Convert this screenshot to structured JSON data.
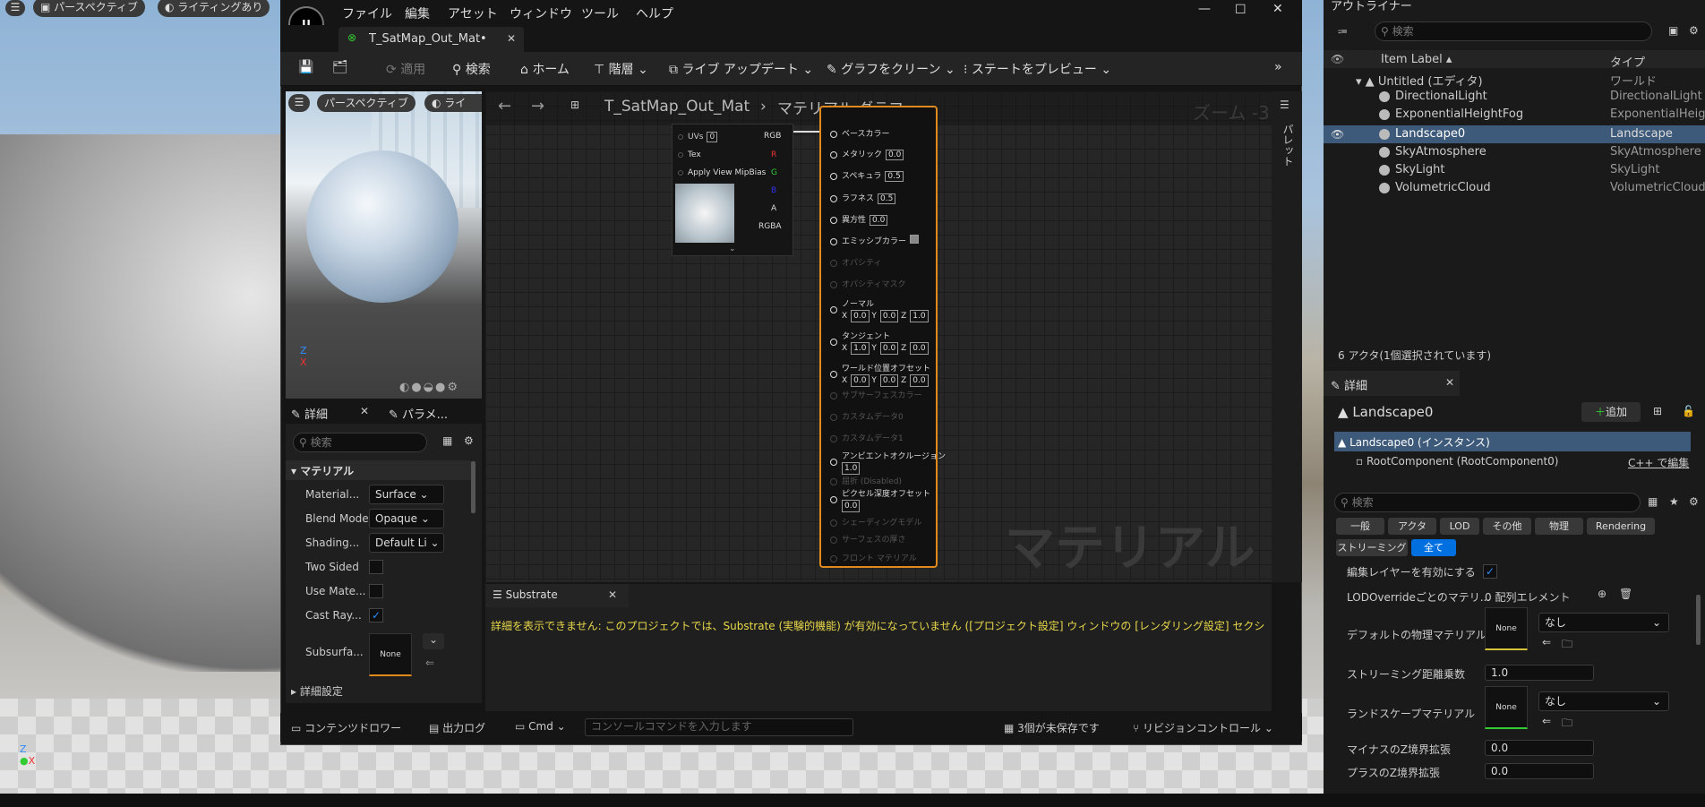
{
  "viewport": {
    "perspective": "パースペクティブ",
    "lighting": "ライティングあり"
  },
  "menu": {
    "file": "ファイル",
    "edit": "編集",
    "asset": "アセット",
    "window": "ウィンドウ",
    "tools": "ツール",
    "help": "ヘルプ"
  },
  "tab": {
    "title": "T_SatMap_Out_Mat•"
  },
  "toolbar": {
    "apply": "適用",
    "search": "検索",
    "home": "ホーム",
    "hierarchy": "階層",
    "live_update": "ライブ アップデート",
    "clean_graph": "グラフをクリーン",
    "preview_state": "ステートをプレビュー"
  },
  "preview": {
    "perspective": "パースペクティブ",
    "lighting": "ライテ"
  },
  "graph": {
    "breadcrumb_asset": "T_SatMap_Out_Mat",
    "breadcrumb_graph": "マテリアル グラフ",
    "zoom": "ズーム -3",
    "watermark": "マテリアル",
    "palette": "パレット",
    "sampler": {
      "uvs": "UVs",
      "uvs_val": "0",
      "tex": "Tex",
      "mip": "Apply View MipBias",
      "rgb": "RGB",
      "r": "R",
      "g": "G",
      "b": "B",
      "a": "A",
      "rgba": "RGBA"
    },
    "pins": {
      "base_color": "ベースカラー",
      "metallic": "メタリック",
      "metallic_v": "0.0",
      "specular": "スペキュラ",
      "specular_v": "0.5",
      "roughness": "ラフネス",
      "roughness_v": "0.5",
      "aniso": "異方性",
      "aniso_v": "0.0",
      "emissive": "エミッシブカラー",
      "opacity": "オパシティ",
      "opacity_mask": "オパシティマスク",
      "normal": "ノーマル",
      "tangent": "タンジェント",
      "wpo": "ワールド位置オフセット",
      "subsurface": "サブサーフェスカラー",
      "custom0": "カスタムデータ0",
      "custom1": "カスタムデータ1",
      "ao": "アンビエントオクルージョン",
      "ao_v": "1.0",
      "refraction": "屈折 (Disabled)",
      "pdo": "ピクセル深度オフセット",
      "pdo_v": "0.0",
      "shading_model": "シェーディングモデル",
      "surface_thickness": "サーフェスの厚さ",
      "front_material": "フロント マテリアル",
      "x": "X",
      "y": "Y",
      "z": "Z",
      "zero": "0.0",
      "one": "1.0"
    }
  },
  "details_left": {
    "tab": "詳細",
    "tab2": "パラメ...",
    "search_placeholder": "検索",
    "section": "マテリアル",
    "rows": [
      {
        "label": "Material...",
        "value": "Surface"
      },
      {
        "label": "Blend Mode",
        "value": "Opaque"
      },
      {
        "label": "Shading...",
        "value": "Default Li"
      }
    ],
    "two_sided": "Two Sided",
    "use_mate": "Use Mate...",
    "cast_ray": "Cast Ray...",
    "subsurface": "Subsurfa...",
    "none": "None",
    "advanced": "詳細設定"
  },
  "substrate": {
    "tab": "Substrate",
    "message": "詳細を表示できません: このプロジェクトでは、Substrate (実験的機能) が有効になっていません ([プロジェクト設定] ウィンドウの [レンダリング設定] セクショ"
  },
  "status": {
    "content_drawer": "コンテンツドロワー",
    "output_log": "出力ログ",
    "cmd": "Cmd",
    "console_placeholder": "コンソールコマンドを入力します",
    "unsaved": "3個が未保存です",
    "revision": "リビジョンコントロール"
  },
  "outliner": {
    "title": "アウトライナー",
    "search_placeholder": "検索",
    "col_label": "Item Label",
    "col_type": "タイプ",
    "root": "Untitled (エディタ)",
    "root_type": "ワールド",
    "items": [
      {
        "name": "DirectionalLight",
        "type": "DirectionalLight"
      },
      {
        "name": "ExponentialHeightFog",
        "type": "ExponentialHeightFog"
      },
      {
        "name": "Landscape0",
        "type": "Landscape"
      },
      {
        "name": "SkyAtmosphere",
        "type": "SkyAtmosphere"
      },
      {
        "name": "SkyLight",
        "type": "SkyLight"
      },
      {
        "name": "VolumetricCloud",
        "type": "VolumetricCloud"
      }
    ],
    "count": "6 アクタ(1個選択されています)"
  },
  "details_right": {
    "tab": "詳細",
    "object": "Landscape0",
    "add": "追加",
    "instance": "Landscape0 (インスタンス)",
    "root_component": "RootComponent (RootComponent0)",
    "edit_cpp": "C++ で編集",
    "search_placeholder": "検索",
    "chips": [
      "一般",
      "アクタ",
      "LOD",
      "その他",
      "物理",
      "Rendering",
      "ストリーミング",
      "全て"
    ],
    "enable_edit_layers": "編集レイヤーを有効にする",
    "lod_override": "LODOverrideごとのマテリ...",
    "lod_override_v": "0 配列エレメント",
    "default_phys": "デフォルトの物理マテリアル",
    "none": "None",
    "nashi": "なし",
    "stream_dist": "ストリーミング距離乗数",
    "stream_dist_v": "1.0",
    "landscape_mat": "ランドスケープマテリアル",
    "neg_z": "マイナスのZ境界拡張",
    "neg_z_v": "0.0",
    "pos_z": "プラスのZ境界拡張",
    "pos_z_v": "0.0"
  }
}
